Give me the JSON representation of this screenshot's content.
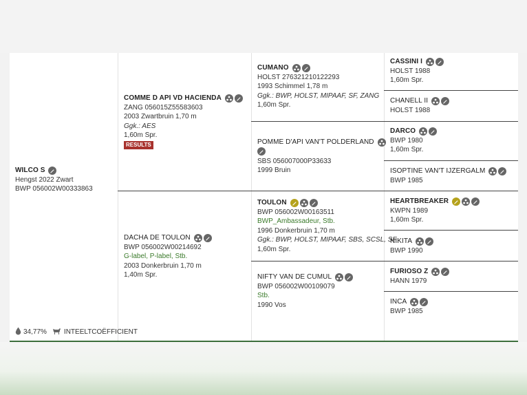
{
  "pedigree": {
    "subject": {
      "name": "WILCO S",
      "line1": "Hengst 2022 Zwart",
      "line2": "BWP 056002W00333863"
    },
    "sire": {
      "name": "COMME D API VD HACIENDA",
      "line1": "ZANG 056015Z55583603",
      "line2": "2003 Zwartbruin 1,70 m",
      "line3": "Ggk.: AES",
      "line4": "1,60m Spr.",
      "badge": "RESULTS"
    },
    "dam": {
      "name": "DACHA DE TOULON",
      "line1": "BWP 056002W00214692",
      "line2": "G-label, P-label, Stb.",
      "line3": "2003 Donkerbruin 1,70 m",
      "line4": "1,40m Spr."
    },
    "ss": {
      "name": "CUMANO",
      "line1": "HOLST 276321210122293",
      "line2": "1993 Schimmel 1,78 m",
      "line3": "Ggk.: BWP, HOLST, MIPAAF, SF, ZANG",
      "line4": "1,60m Spr."
    },
    "sd": {
      "name": "POMME D'API VAN'T POLDERLAND",
      "line1": "SBS 056007000P33633",
      "line2": "1999 Bruin"
    },
    "ds": {
      "name": "TOULON",
      "line1": "BWP 056002W00163511",
      "line2": "BWP_Ambassadeur, Stb.",
      "line3": "1996 Donkerbruin 1,70 m",
      "line4": "Ggk.: BWP, HOLST, MIPAAF, SBS, SCSL, SF",
      "line5": "1,60m Spr."
    },
    "dd": {
      "name": "NIFTY VAN DE CUMUL",
      "line1": "BWP 056002W00109079",
      "line2": "Stb.",
      "line3": "1990 Vos"
    },
    "sss": {
      "name": "CASSINI I",
      "line1": "HOLST 1988",
      "line2": "1,60m Spr."
    },
    "ssd": {
      "name": "CHANELL II",
      "line1": "HOLST 1988"
    },
    "sds": {
      "name": "DARCO",
      "line1": "BWP 1980",
      "line2": "1,60m Spr."
    },
    "sdd": {
      "name": "ISOPTINE VAN'T IJZERGALM",
      "line1": "BWP 1985"
    },
    "dss": {
      "name": "HEARTBREAKER",
      "line1": "KWPN 1989",
      "line2": "1,60m Spr."
    },
    "dsd": {
      "name": "NIKITA",
      "line1": "BWP 1990"
    },
    "dds": {
      "name": "FURIOSO Z",
      "line1": "HANN 1979"
    },
    "ddd": {
      "name": "INCA",
      "line1": "BWP 1985"
    }
  },
  "footer": {
    "inbreeding_value": "34,77%",
    "inbreeding_label": "INTEELTCOËFFICIENT"
  },
  "icons": {
    "pedigree": "pedigree-icon",
    "edit": "pencil-icon",
    "stallion-premium": "gold-pencil-icon",
    "drop": "drop-icon",
    "horse": "horse-icon"
  },
  "colors": {
    "accent_green": "#3a7a2a",
    "badge_red": "#a8322d",
    "gold": "#b5a21c",
    "icon_gray": "#666666"
  }
}
